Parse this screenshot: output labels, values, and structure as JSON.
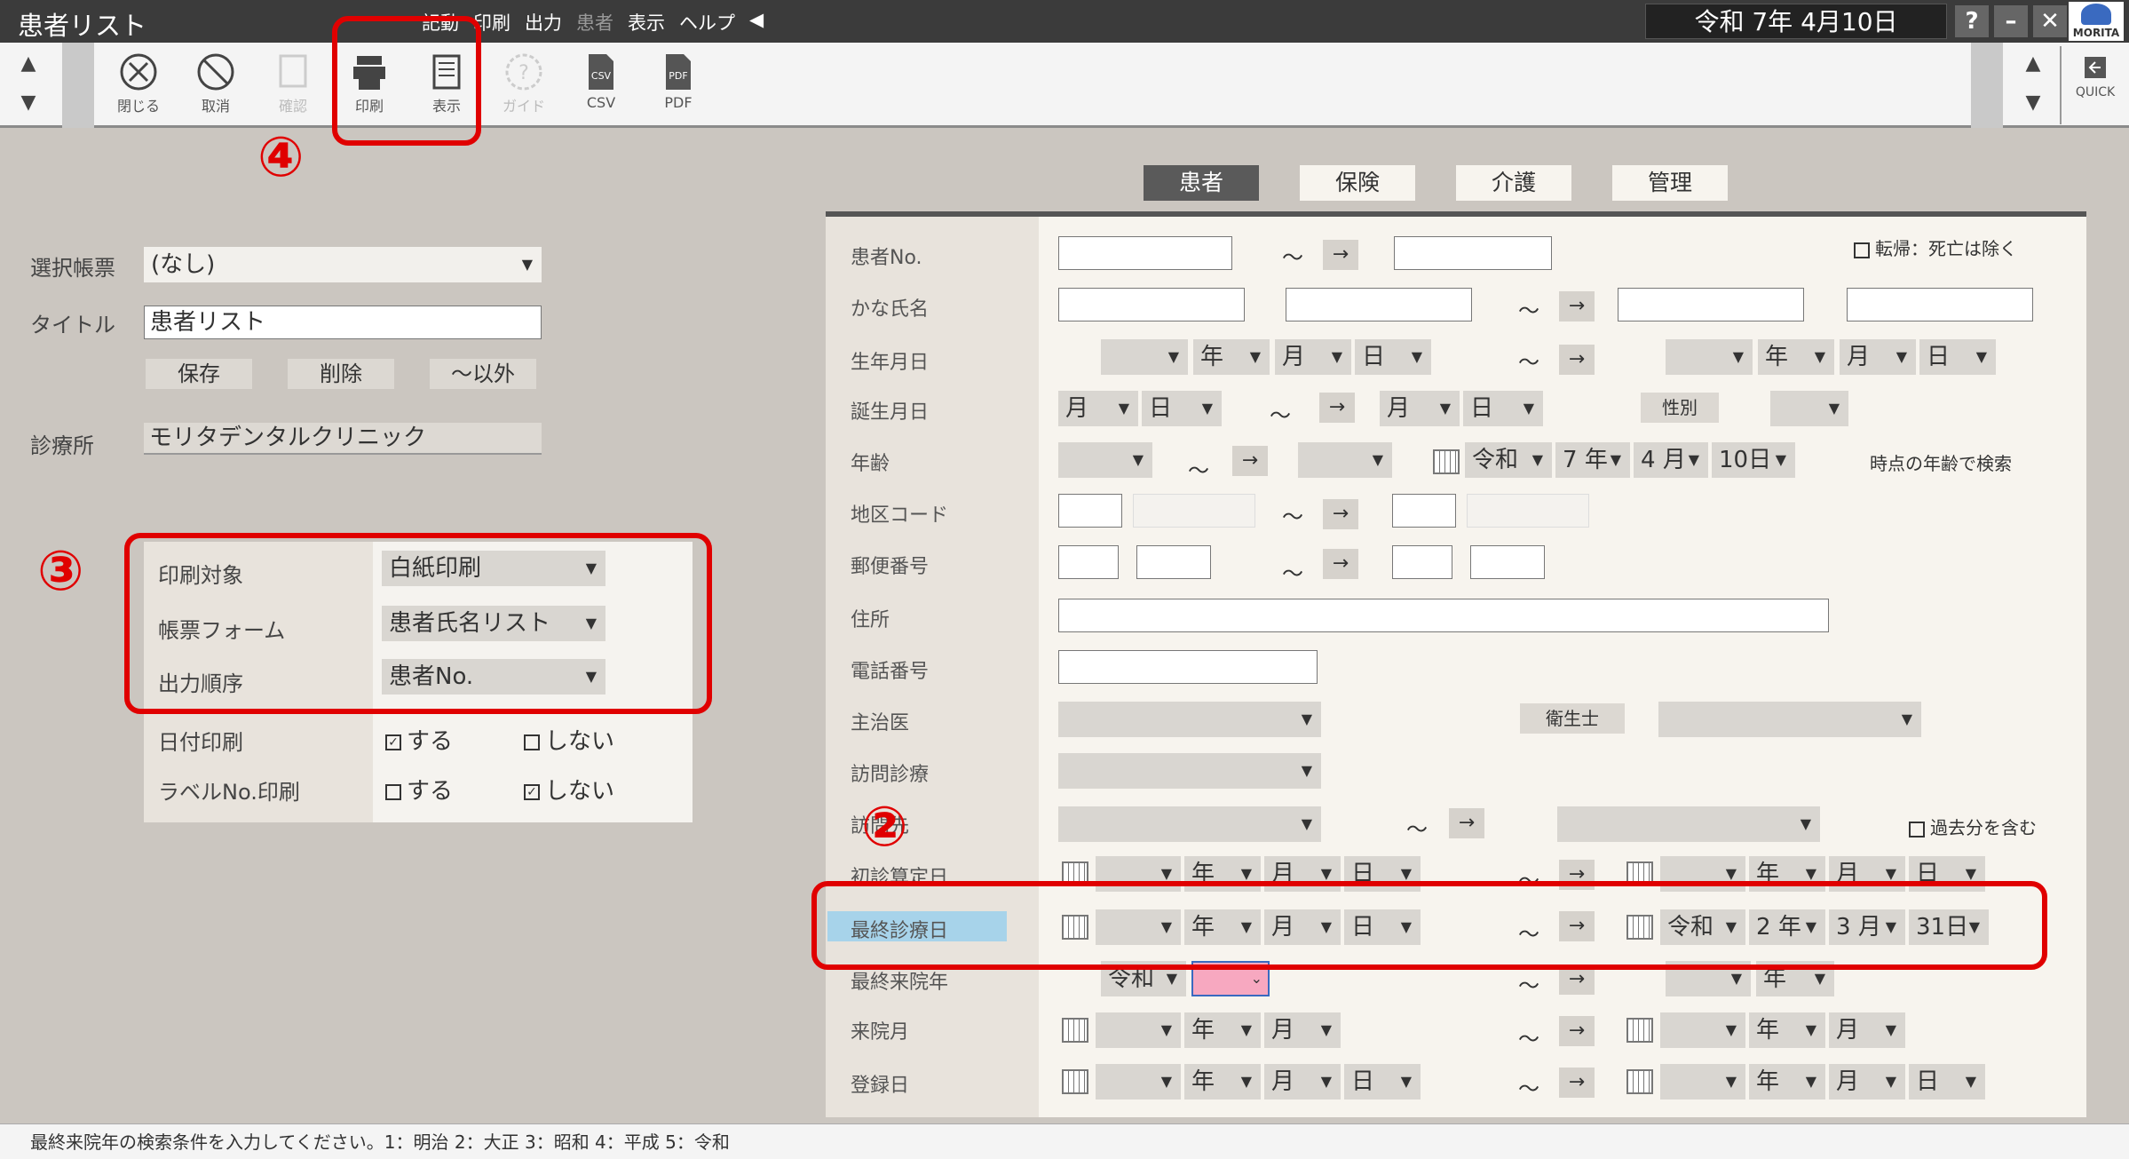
{
  "window": {
    "title": "患者リスト",
    "date": "令和 7年 4月10日",
    "help": "?",
    "minimize": "–",
    "close": "✕",
    "logo": "MORITA"
  },
  "menu": [
    "記動",
    "印刷",
    "出力",
    "患者",
    "表示",
    "ヘルプ"
  ],
  "toolbar": {
    "close": "閉じる",
    "cancel": "取消",
    "confirm": "確認",
    "print": "印刷",
    "display": "表示",
    "guide": "ガイド",
    "csv": "CSV",
    "pdf": "PDF",
    "quick": "QUICK"
  },
  "left": {
    "select_label": "選択帳票",
    "select_value": "(なし)",
    "title_label": "タイトル",
    "title_value": "患者リスト",
    "save": "保存",
    "delete": "削除",
    "except": "～以外",
    "clinic_label": "診療所",
    "clinic_value": "モリタデンタルクリニック",
    "print_target_label": "印刷対象",
    "print_target_value": "白紙印刷",
    "form_label": "帳票フォーム",
    "form_value": "患者氏名リスト",
    "order_label": "出力順序",
    "order_value": "患者No.",
    "date_print_label": "日付印刷",
    "label_print_label": "ラベルNo.印刷",
    "yes": "する",
    "no": "しない"
  },
  "tabs": [
    "患者",
    "保険",
    "介護",
    "管理"
  ],
  "fields": {
    "patient_no": "患者No.",
    "kana": "かな氏名",
    "birthdate": "生年月日",
    "birthday": "誕生月日",
    "age": "年齢",
    "area": "地区コード",
    "postal": "郵便番号",
    "address": "住所",
    "phone": "電話番号",
    "doctor": "主治医",
    "visit_care": "訪問診療",
    "visit_to": "訪問先",
    "first_calc": "初診算定日",
    "last_visit_date": "最終診療日",
    "last_visit_year": "最終来院年",
    "visit_month": "来院月",
    "reg_date": "登録日"
  },
  "misc": {
    "tenki": "転帰：死亡は除く",
    "past": "過去分を含む",
    "sex": "性別",
    "hygienist": "衛生士",
    "age_note": "時点の年齢で検索",
    "era": "令和",
    "age_year": "7",
    "age_month": "4",
    "age_day": "10日",
    "end_year": "2",
    "end_month": "3",
    "end_day": "31日",
    "nen": "年",
    "tsuki": "月",
    "hi": "日",
    "tilde": "～",
    "arrow": "→"
  },
  "status": "最終来院年の検索条件を入力してください。1：明治 2：大正 3：昭和 4：平成 5：令和",
  "annotations": [
    "④",
    "③",
    "②"
  ]
}
